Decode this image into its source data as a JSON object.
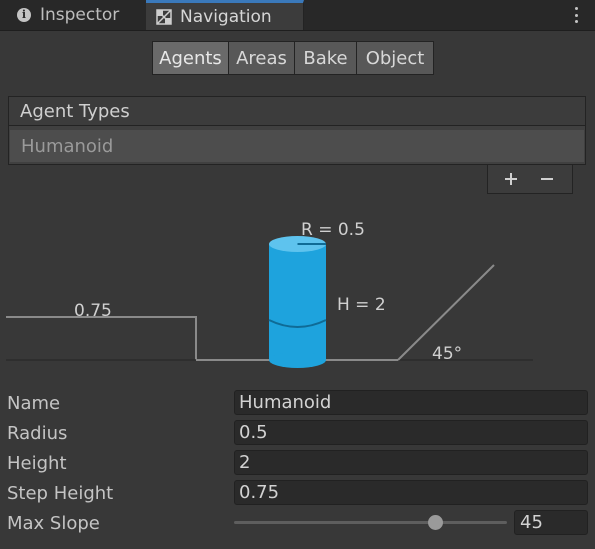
{
  "tabs": {
    "inspector": {
      "label": "Inspector",
      "icon": "info-icon"
    },
    "navigation": {
      "label": "Navigation",
      "icon": "navmesh-icon",
      "active": true
    }
  },
  "segments": [
    {
      "label": "Agents",
      "active": true
    },
    {
      "label": "Areas",
      "active": false
    },
    {
      "label": "Bake",
      "active": false
    },
    {
      "label": "Object",
      "active": false
    }
  ],
  "agent_types": {
    "header": "Agent Types",
    "items": [
      "Humanoid"
    ],
    "selected": 0,
    "add_icon": "plus-icon",
    "remove_icon": "minus-icon"
  },
  "diagram": {
    "radius_label": "R = 0.5",
    "height_label": "H = 2",
    "step_label": "0.75",
    "slope_label": "45°",
    "agent_color": "#1ea3dd"
  },
  "fields": {
    "name": {
      "label": "Name",
      "value": "Humanoid"
    },
    "radius": {
      "label": "Radius",
      "value": "0.5"
    },
    "height": {
      "label": "Height",
      "value": "2"
    },
    "step_height": {
      "label": "Step Height",
      "value": "0.75"
    },
    "max_slope": {
      "label": "Max Slope",
      "value": "45",
      "min": 0,
      "max": 60
    }
  }
}
